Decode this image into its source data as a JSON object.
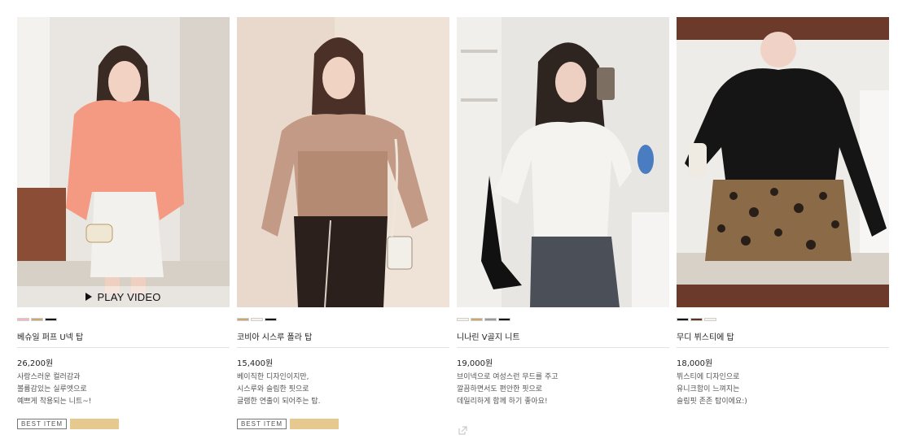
{
  "products": [
    {
      "name": "베슈일 퍼프 U넥 탑",
      "price": "26,200원",
      "desc": [
        "사랑스러운 컬러감과",
        "볼륨감있는 실루엣으로",
        "예쁘게 착용되는 니트~!"
      ],
      "swatches": [
        "#f4b6c2",
        "#c8a86b",
        "#111111"
      ],
      "play_label": "PLAY VIDEO",
      "badge": "BEST ITEM"
    },
    {
      "name": "코비아 시스루 폴라 탑",
      "price": "15,400원",
      "desc": [
        "베이직한 디자인이지만,",
        "시스루와 슬림한 핏으로",
        "글램한 연출이 되어주는 탑."
      ],
      "swatches": [
        "#c8a86b",
        "#f7f3ea",
        "#111111"
      ],
      "badge": "BEST ITEM"
    },
    {
      "name": "니나린 V골지 니트",
      "price": "19,000원",
      "desc": [
        "브이넥으로 여성스런 무드를 주고",
        "깔끔하면서도 편안한 핏으로",
        "데일리하게 함께 하기 좋아요!"
      ],
      "swatches": [
        "#f7f3ea",
        "#c8a86b",
        "#9a9a9a",
        "#111111"
      ],
      "share_icon": "share-icon"
    },
    {
      "name": "무디 뷔스티에 탑",
      "price": "18,000원",
      "desc": [
        "뷔스티에 디자인으로",
        "유니크함이 느껴지는",
        "슬림핏 존존 탑이에요:)"
      ],
      "swatches": [
        "#111111",
        "#5a3424",
        "#f7f3ea"
      ]
    }
  ]
}
